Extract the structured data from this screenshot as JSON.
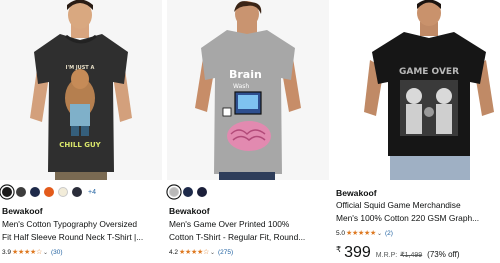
{
  "products": [
    {
      "brand": "Bewakoof",
      "title_line1": "Men's Cotton Typography Oversized",
      "title_line2": "Fit Half Sleeve Round Neck T-Shirt |...",
      "print_line1": "I'M JUST A",
      "print_line2": "CHILL GUY",
      "swatches": [
        "#1b1b1b",
        "#3d3d3d",
        "#1e2a4a",
        "#e35b1b",
        "#f2ecd9",
        "#2a2d3a"
      ],
      "more_colors": "+4",
      "rating": "3.9",
      "stars": "★★★★☆",
      "review_count": "(30)"
    },
    {
      "brand": "Bewakoof",
      "title_line1": "Men's Game Over Printed 100%",
      "title_line2": "Cotton T-Shirt - Regular Fit, Round...",
      "print_line1": "Brain",
      "print_line2": "Wash",
      "swatches": [
        "#b9b9b9",
        "#1e2a4a",
        "#1b1f3a"
      ],
      "rating": "4.2",
      "stars": "★★★★☆",
      "review_count": "(275)"
    },
    {
      "brand": "Bewakoof",
      "title_line1": "Official Squid Game Merchandise",
      "title_line2": "Men's 100% Cotton 220 GSM Graph...",
      "print_line1": "GAME OVER",
      "rating": "5.0",
      "stars": "★★★★★",
      "review_count": "(2)",
      "currency": "₹",
      "price": "399",
      "mrp_label": "M.R.P:",
      "mrp": "₹1,499",
      "discount": "(73% off)"
    }
  ],
  "colors": {
    "star": "#de7921",
    "link": "#2162a1",
    "text": "#0f1111"
  }
}
